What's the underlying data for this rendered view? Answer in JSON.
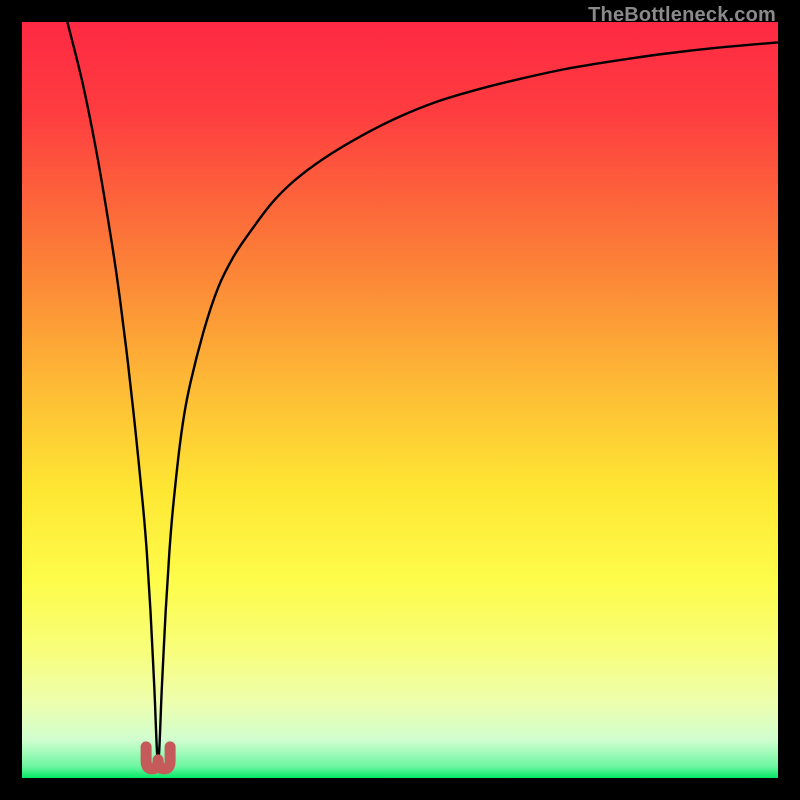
{
  "watermark": "TheBottleneck.com",
  "chart_data": {
    "type": "line",
    "title": "",
    "xlabel": "",
    "ylabel": "",
    "xlim": [
      0,
      100
    ],
    "ylim": [
      0,
      100
    ],
    "grid": false,
    "legend": false,
    "background_gradient": {
      "top": "#fe2943",
      "upper_mid": "#fc8d37",
      "mid": "#fee733",
      "lower_mid": "#f8fe7a",
      "near_bottom": "#d9fecb",
      "bottom": "#02e966"
    },
    "notch_marker": {
      "x": 18,
      "y": 2,
      "color": "#c55a5a"
    },
    "series": [
      {
        "name": "curve",
        "color": "#000000",
        "x": [
          6,
          8,
          10,
          12,
          13,
          14,
          15,
          16,
          16.5,
          17,
          17.5,
          18,
          18.5,
          19,
          19.5,
          20,
          21,
          22,
          24,
          26,
          28,
          30,
          33,
          36,
          40,
          45,
          50,
          55,
          60,
          66,
          72,
          78,
          85,
          92,
          100
        ],
        "y": [
          100,
          92,
          82,
          70,
          63,
          55,
          46,
          36,
          30,
          22,
          12,
          2,
          12,
          22,
          30,
          36,
          45,
          51,
          59,
          65,
          69,
          72,
          76,
          79,
          82,
          85,
          87.5,
          89.5,
          91,
          92.5,
          93.8,
          94.8,
          95.8,
          96.6,
          97.3
        ]
      }
    ]
  }
}
